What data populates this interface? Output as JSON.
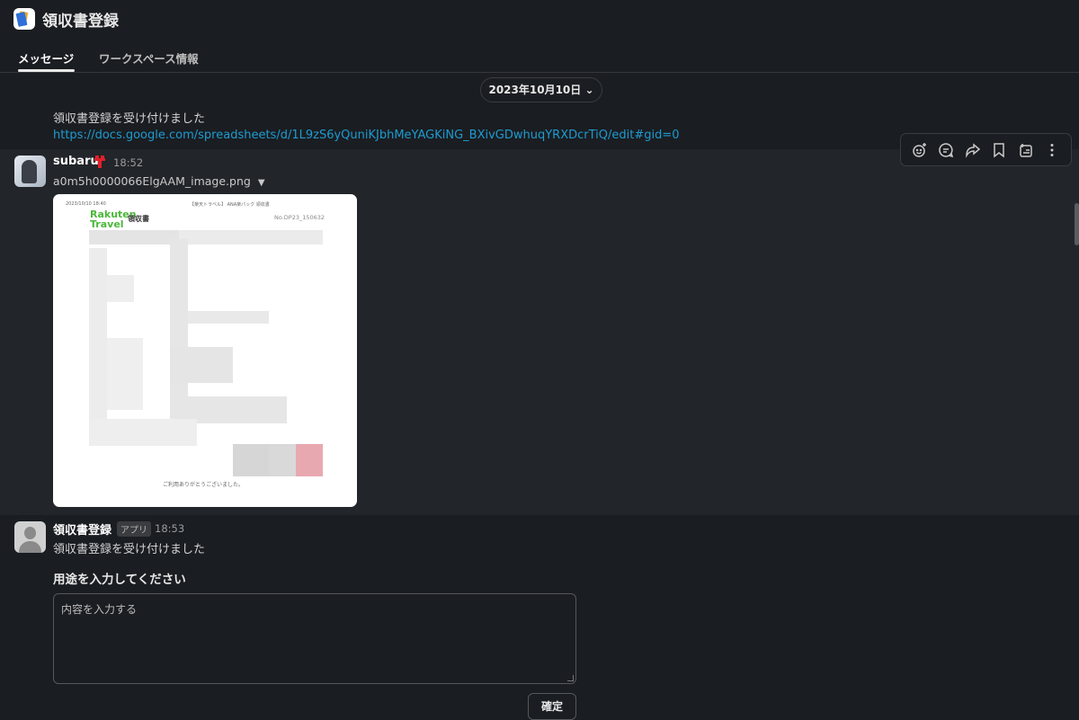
{
  "header": {
    "title": "領収書登録",
    "tabs": [
      {
        "label": "メッセージ"
      },
      {
        "label": "ワークスペース情報"
      }
    ]
  },
  "date_divider": "2023年10月10日 ⌄",
  "messages": [
    {
      "text": "領収書登録を受け付けました",
      "link": "https://docs.google.com/spreadsheets/d/1L9zS6yQuniKJbhMeYAGKiNG_BXivGDwhuqYRXDcrTiQ/edit#gid=0"
    },
    {
      "author": "subaru",
      "time": "18:52",
      "filename": "a0m5h0000066ElgAAM_image.png",
      "receipt": {
        "logo": "Rakuten Travel",
        "title": "領収書",
        "number": "No.DP23_150632",
        "thanks": "ご利用ありがとうございました。",
        "date": "2023/10/10 18:40",
        "header_note": "【楽天トラベル】 ANA楽パック 領収書"
      }
    },
    {
      "author": "領収書登録",
      "badge": "アプリ",
      "time": "18:53",
      "text": "領収書登録を受け付けました",
      "form_label": "用途を入力してください",
      "placeholder": "内容を入力する",
      "button": "確定"
    }
  ],
  "toolbar": [
    "add-reaction",
    "reply-in-thread",
    "forward",
    "save",
    "add-to-list",
    "more"
  ]
}
